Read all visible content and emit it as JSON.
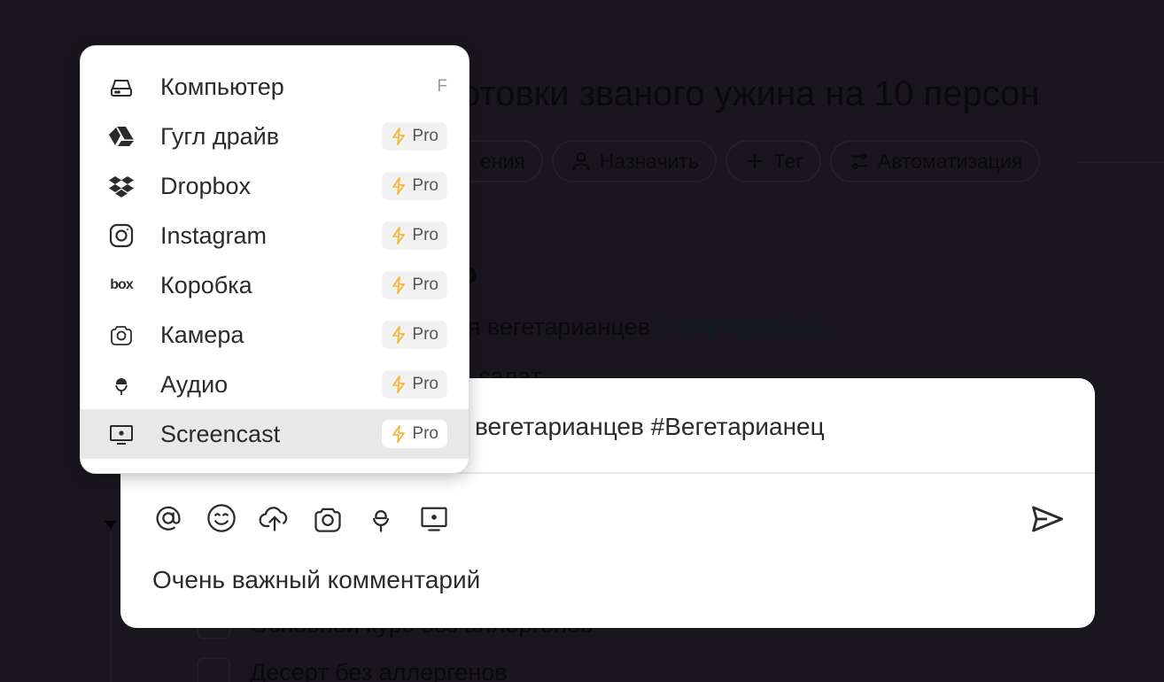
{
  "background": {
    "title": "отовки званого ужина на 10 персон",
    "chips": [
      "ения",
      "Назначить",
      "Тег",
      "Автоматизация"
    ],
    "heading": "о",
    "line1": "ля вегетарианцев ",
    "line1_tag": "#Вегетарианец",
    "line2": "салат",
    "line3": "Основной курс без аллергенов",
    "line4": "Десерт без аллергенов"
  },
  "composer": {
    "text": "вегетарианцев #Вегетарианец",
    "hint": "Очень важный комментарий",
    "tools": [
      "at-icon",
      "emoji-icon",
      "upload-icon",
      "camera-icon",
      "microphone-icon",
      "screencast-icon"
    ],
    "send_icon": "send-icon"
  },
  "menu": {
    "items": [
      {
        "label": "Компьютер",
        "icon": "drive-icon",
        "shortcut": "F"
      },
      {
        "label": "Гугл драйв",
        "icon": "google-drive-icon",
        "badge": "Pro"
      },
      {
        "label": "Dropbox",
        "icon": "dropbox-icon",
        "badge": "Pro"
      },
      {
        "label": "Instagram",
        "icon": "instagram-icon",
        "badge": "Pro"
      },
      {
        "label": "Коробка",
        "icon": "box-icon",
        "badge": "Pro",
        "icon_text": "box"
      },
      {
        "label": "Камера",
        "icon": "camera-icon",
        "badge": "Pro"
      },
      {
        "label": "Аудио",
        "icon": "microphone-icon",
        "badge": "Pro"
      },
      {
        "label": "Screencast",
        "icon": "screencast-icon",
        "badge": "Pro",
        "active": true
      }
    ]
  },
  "colors": {
    "backdrop": "#1a161d",
    "panel": "#ffffff",
    "active_row": "#e8e8e8",
    "pro_bolt": "#f5b83d",
    "text": "#2b2b2b"
  }
}
